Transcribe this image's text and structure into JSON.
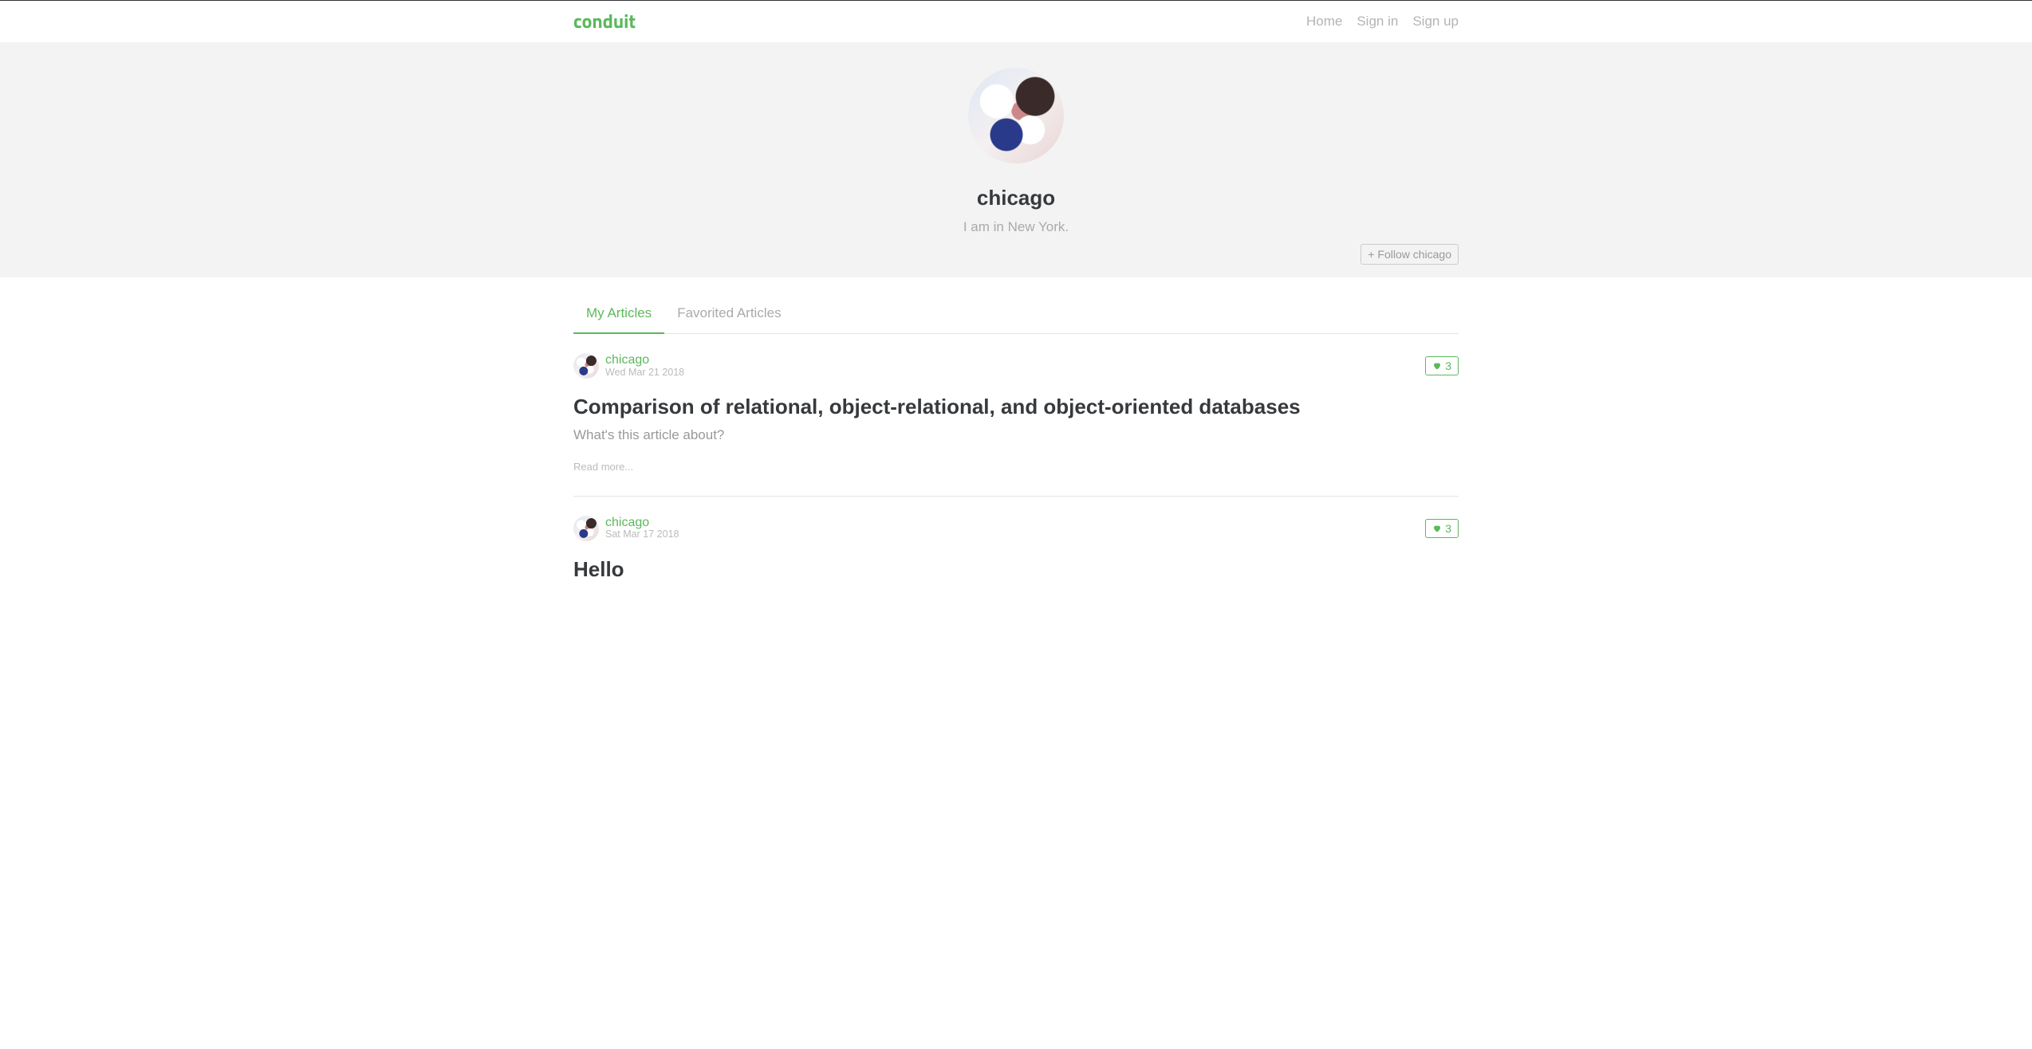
{
  "brand": "conduit",
  "nav": {
    "home": "Home",
    "signin": "Sign in",
    "signup": "Sign up"
  },
  "profile": {
    "username": "chicago",
    "bio": "I am in New York.",
    "follow_label": "Follow chicago"
  },
  "tabs": {
    "my": "My Articles",
    "fav": "Favorited Articles"
  },
  "articles": [
    {
      "author": "chicago",
      "date": "Wed Mar 21 2018",
      "favorites": "3",
      "title": "Comparison of relational, object-relational, and object-oriented databases",
      "description": "What's this article about?",
      "read_more": "Read more..."
    },
    {
      "author": "chicago",
      "date": "Sat Mar 17 2018",
      "favorites": "3",
      "title": "Hello",
      "description": "",
      "read_more": ""
    }
  ]
}
